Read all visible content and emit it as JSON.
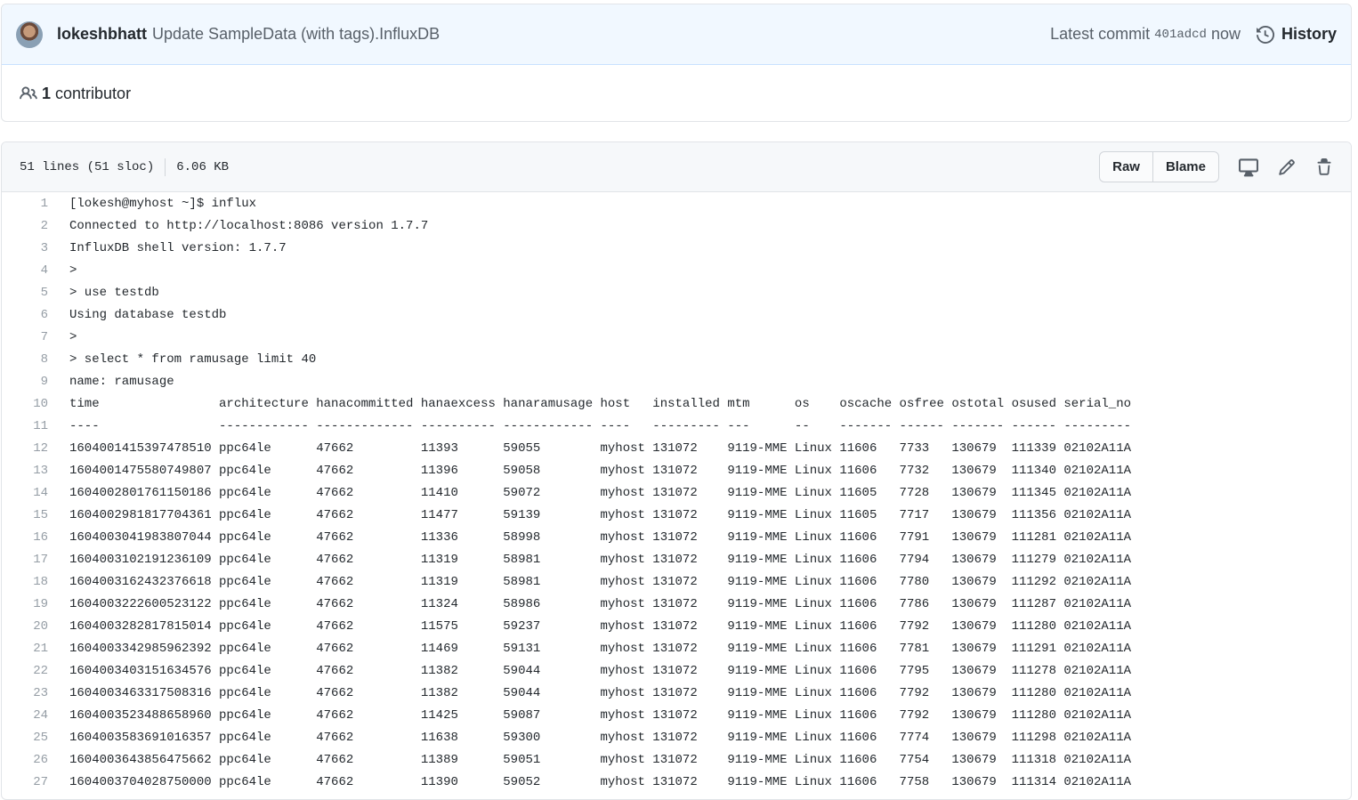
{
  "commit": {
    "author": "lokeshbhatt",
    "message": "Update SampleData (with tags).InfluxDB",
    "latest_label": "Latest commit",
    "sha": "401adcd",
    "time": "now",
    "history_label": "History"
  },
  "contributors": {
    "count": "1",
    "label": "contributor"
  },
  "file": {
    "lines_info": "51 lines (51 sloc)",
    "size": "6.06 KB",
    "raw_label": "Raw",
    "blame_label": "Blame"
  },
  "icons": {
    "history": "history-icon",
    "people": "people-icon",
    "desktop": "desktop-icon",
    "edit": "pencil-icon",
    "delete": "trash-icon"
  },
  "code_lines": [
    {
      "n": "1",
      "text": "[lokesh@myhost ~]$ influx"
    },
    {
      "n": "2",
      "text": "Connected to http://localhost:8086 version 1.7.7"
    },
    {
      "n": "3",
      "text": "InfluxDB shell version: 1.7.7"
    },
    {
      "n": "4",
      "text": ">"
    },
    {
      "n": "5",
      "text": "> use testdb"
    },
    {
      "n": "6",
      "text": "Using database testdb"
    },
    {
      "n": "7",
      "text": ">"
    },
    {
      "n": "8",
      "text": "> select * from ramusage limit 40"
    },
    {
      "n": "9",
      "text": "name: ramusage"
    },
    {
      "n": "10",
      "text": "time                architecture hanacommitted hanaexcess hanaramusage host   installed mtm      os    oscache osfree ostotal osused serial_no"
    },
    {
      "n": "11",
      "text": "----                ------------ ------------- ---------- ------------ ----   --------- ---      --    ------- ------ ------- ------ ---------"
    },
    {
      "n": "12",
      "text": "1604001415397478510 ppc64le      47662         11393      59055        myhost 131072    9119-MME Linux 11606   7733   130679  111339 02102A11A"
    },
    {
      "n": "13",
      "text": "1604001475580749807 ppc64le      47662         11396      59058        myhost 131072    9119-MME Linux 11606   7732   130679  111340 02102A11A"
    },
    {
      "n": "14",
      "text": "1604002801761150186 ppc64le      47662         11410      59072        myhost 131072    9119-MME Linux 11605   7728   130679  111345 02102A11A"
    },
    {
      "n": "15",
      "text": "1604002981817704361 ppc64le      47662         11477      59139        myhost 131072    9119-MME Linux 11605   7717   130679  111356 02102A11A"
    },
    {
      "n": "16",
      "text": "1604003041983807044 ppc64le      47662         11336      58998        myhost 131072    9119-MME Linux 11606   7791   130679  111281 02102A11A"
    },
    {
      "n": "17",
      "text": "1604003102191236109 ppc64le      47662         11319      58981        myhost 131072    9119-MME Linux 11606   7794   130679  111279 02102A11A"
    },
    {
      "n": "18",
      "text": "1604003162432376618 ppc64le      47662         11319      58981        myhost 131072    9119-MME Linux 11606   7780   130679  111292 02102A11A"
    },
    {
      "n": "19",
      "text": "1604003222600523122 ppc64le      47662         11324      58986        myhost 131072    9119-MME Linux 11606   7786   130679  111287 02102A11A"
    },
    {
      "n": "20",
      "text": "1604003282817815014 ppc64le      47662         11575      59237        myhost 131072    9119-MME Linux 11606   7792   130679  111280 02102A11A"
    },
    {
      "n": "21",
      "text": "1604003342985962392 ppc64le      47662         11469      59131        myhost 131072    9119-MME Linux 11606   7781   130679  111291 02102A11A"
    },
    {
      "n": "22",
      "text": "1604003403151634576 ppc64le      47662         11382      59044        myhost 131072    9119-MME Linux 11606   7795   130679  111278 02102A11A"
    },
    {
      "n": "23",
      "text": "1604003463317508316 ppc64le      47662         11382      59044        myhost 131072    9119-MME Linux 11606   7792   130679  111280 02102A11A"
    },
    {
      "n": "24",
      "text": "1604003523488658960 ppc64le      47662         11425      59087        myhost 131072    9119-MME Linux 11606   7792   130679  111280 02102A11A"
    },
    {
      "n": "25",
      "text": "1604003583691016357 ppc64le      47662         11638      59300        myhost 131072    9119-MME Linux 11606   7774   130679  111298 02102A11A"
    },
    {
      "n": "26",
      "text": "1604003643856475662 ppc64le      47662         11389      59051        myhost 131072    9119-MME Linux 11606   7754   130679  111318 02102A11A"
    },
    {
      "n": "27",
      "text": "1604003704028750000 ppc64le      47662         11390      59052        myhost 131072    9119-MME Linux 11606   7758   130679  111314 02102A11A"
    }
  ]
}
